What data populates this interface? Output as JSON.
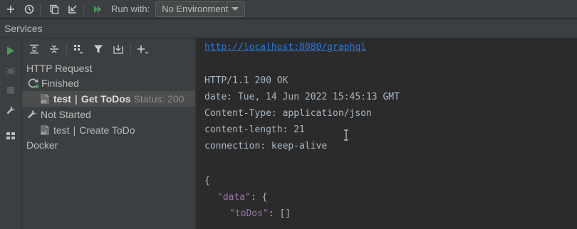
{
  "toolbar": {
    "run_with_label": "Run with:",
    "environment_value": "No Environment"
  },
  "services_title": "Services",
  "tree": {
    "http_request": "HTTP Request",
    "finished": "Finished",
    "finished_item": {
      "env": "test",
      "name": "Get ToDos",
      "status": "Status: 200"
    },
    "not_started": "Not Started",
    "not_started_item": {
      "env": "test",
      "name": "Create ToDo"
    },
    "docker": "Docker"
  },
  "response": {
    "url": "http://localhost:8080/graphql",
    "status_line": "HTTP/1.1 200 OK",
    "date_header": "date: Tue, 14 Jun 2022 15:45:13 GMT",
    "content_type_header": "Content-Type: application/json",
    "content_length_header": "content-length: 21",
    "connection_header": "connection: keep-alive",
    "open_brace": "{",
    "data_key": "\"data\"",
    "data_colon": ": {",
    "todos_key": "\"toDos\"",
    "todos_value": ": []"
  },
  "colors": {
    "link": "#287bde",
    "run_green": "#499c54",
    "json_key": "#9876aa"
  },
  "icons": [
    "add-icon",
    "history-icon",
    "copy-icon",
    "import-icon",
    "run-all-icon",
    "run-icon",
    "debug-icon",
    "stop-icon",
    "wrench-icon",
    "layout-icon",
    "expand-all-icon",
    "collapse-all-icon",
    "group-icon",
    "filter-icon",
    "new-tab-icon",
    "add-service-icon"
  ]
}
